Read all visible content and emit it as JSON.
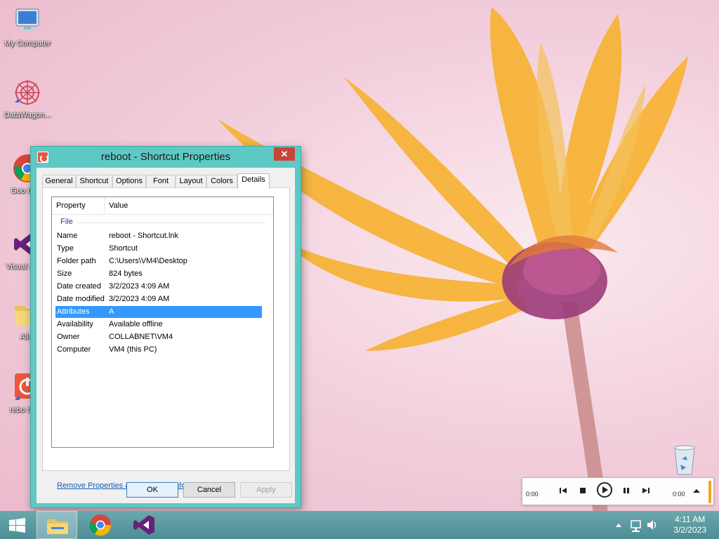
{
  "desktop": {
    "icons": [
      {
        "id": "my-computer",
        "label": "My Computer"
      },
      {
        "id": "datawagon",
        "label": "DataWagon..."
      },
      {
        "id": "google-chrome",
        "label": "Goo Chro"
      },
      {
        "id": "visual-studio",
        "label": "Visual S 201"
      },
      {
        "id": "folder",
        "label": "AllM"
      },
      {
        "id": "reboot",
        "label": "rebo Short"
      }
    ],
    "recycle_bin_icon": "recycle-bin-icon"
  },
  "dialog": {
    "title": "reboot - Shortcut Properties",
    "close_label": "✕",
    "tabs": [
      "General",
      "Shortcut",
      "Options",
      "Font",
      "Layout",
      "Colors",
      "Details"
    ],
    "active_tab": "Details",
    "columns": {
      "property": "Property",
      "value": "Value"
    },
    "group": "File",
    "rows": [
      {
        "property": "Name",
        "value": "reboot - Shortcut.lnk"
      },
      {
        "property": "Type",
        "value": "Shortcut"
      },
      {
        "property": "Folder path",
        "value": "C:\\Users\\VM4\\Desktop"
      },
      {
        "property": "Size",
        "value": "824 bytes"
      },
      {
        "property": "Date created",
        "value": "3/2/2023 4:09 AM"
      },
      {
        "property": "Date modified",
        "value": "3/2/2023 4:09 AM"
      },
      {
        "property": "Attributes",
        "value": "A"
      },
      {
        "property": "Availability",
        "value": "Available offline"
      },
      {
        "property": "Owner",
        "value": "COLLABNET\\VM4"
      },
      {
        "property": "Computer",
        "value": "VM4 (this PC)"
      }
    ],
    "selected_row": "Attributes",
    "remove_link": "Remove Properties and Personal Information",
    "buttons": {
      "ok": "OK",
      "cancel": "Cancel",
      "apply": "Apply"
    }
  },
  "player": {
    "time_left": "0:00",
    "time_right": "0:00",
    "accent_color": "#f0a81e"
  },
  "taskbar": {
    "items": [
      "start-icon",
      "file-explorer-icon",
      "chrome-icon",
      "visual-studio-icon"
    ],
    "clock_time": "4:11 AM",
    "clock_date": "3/2/2023"
  }
}
